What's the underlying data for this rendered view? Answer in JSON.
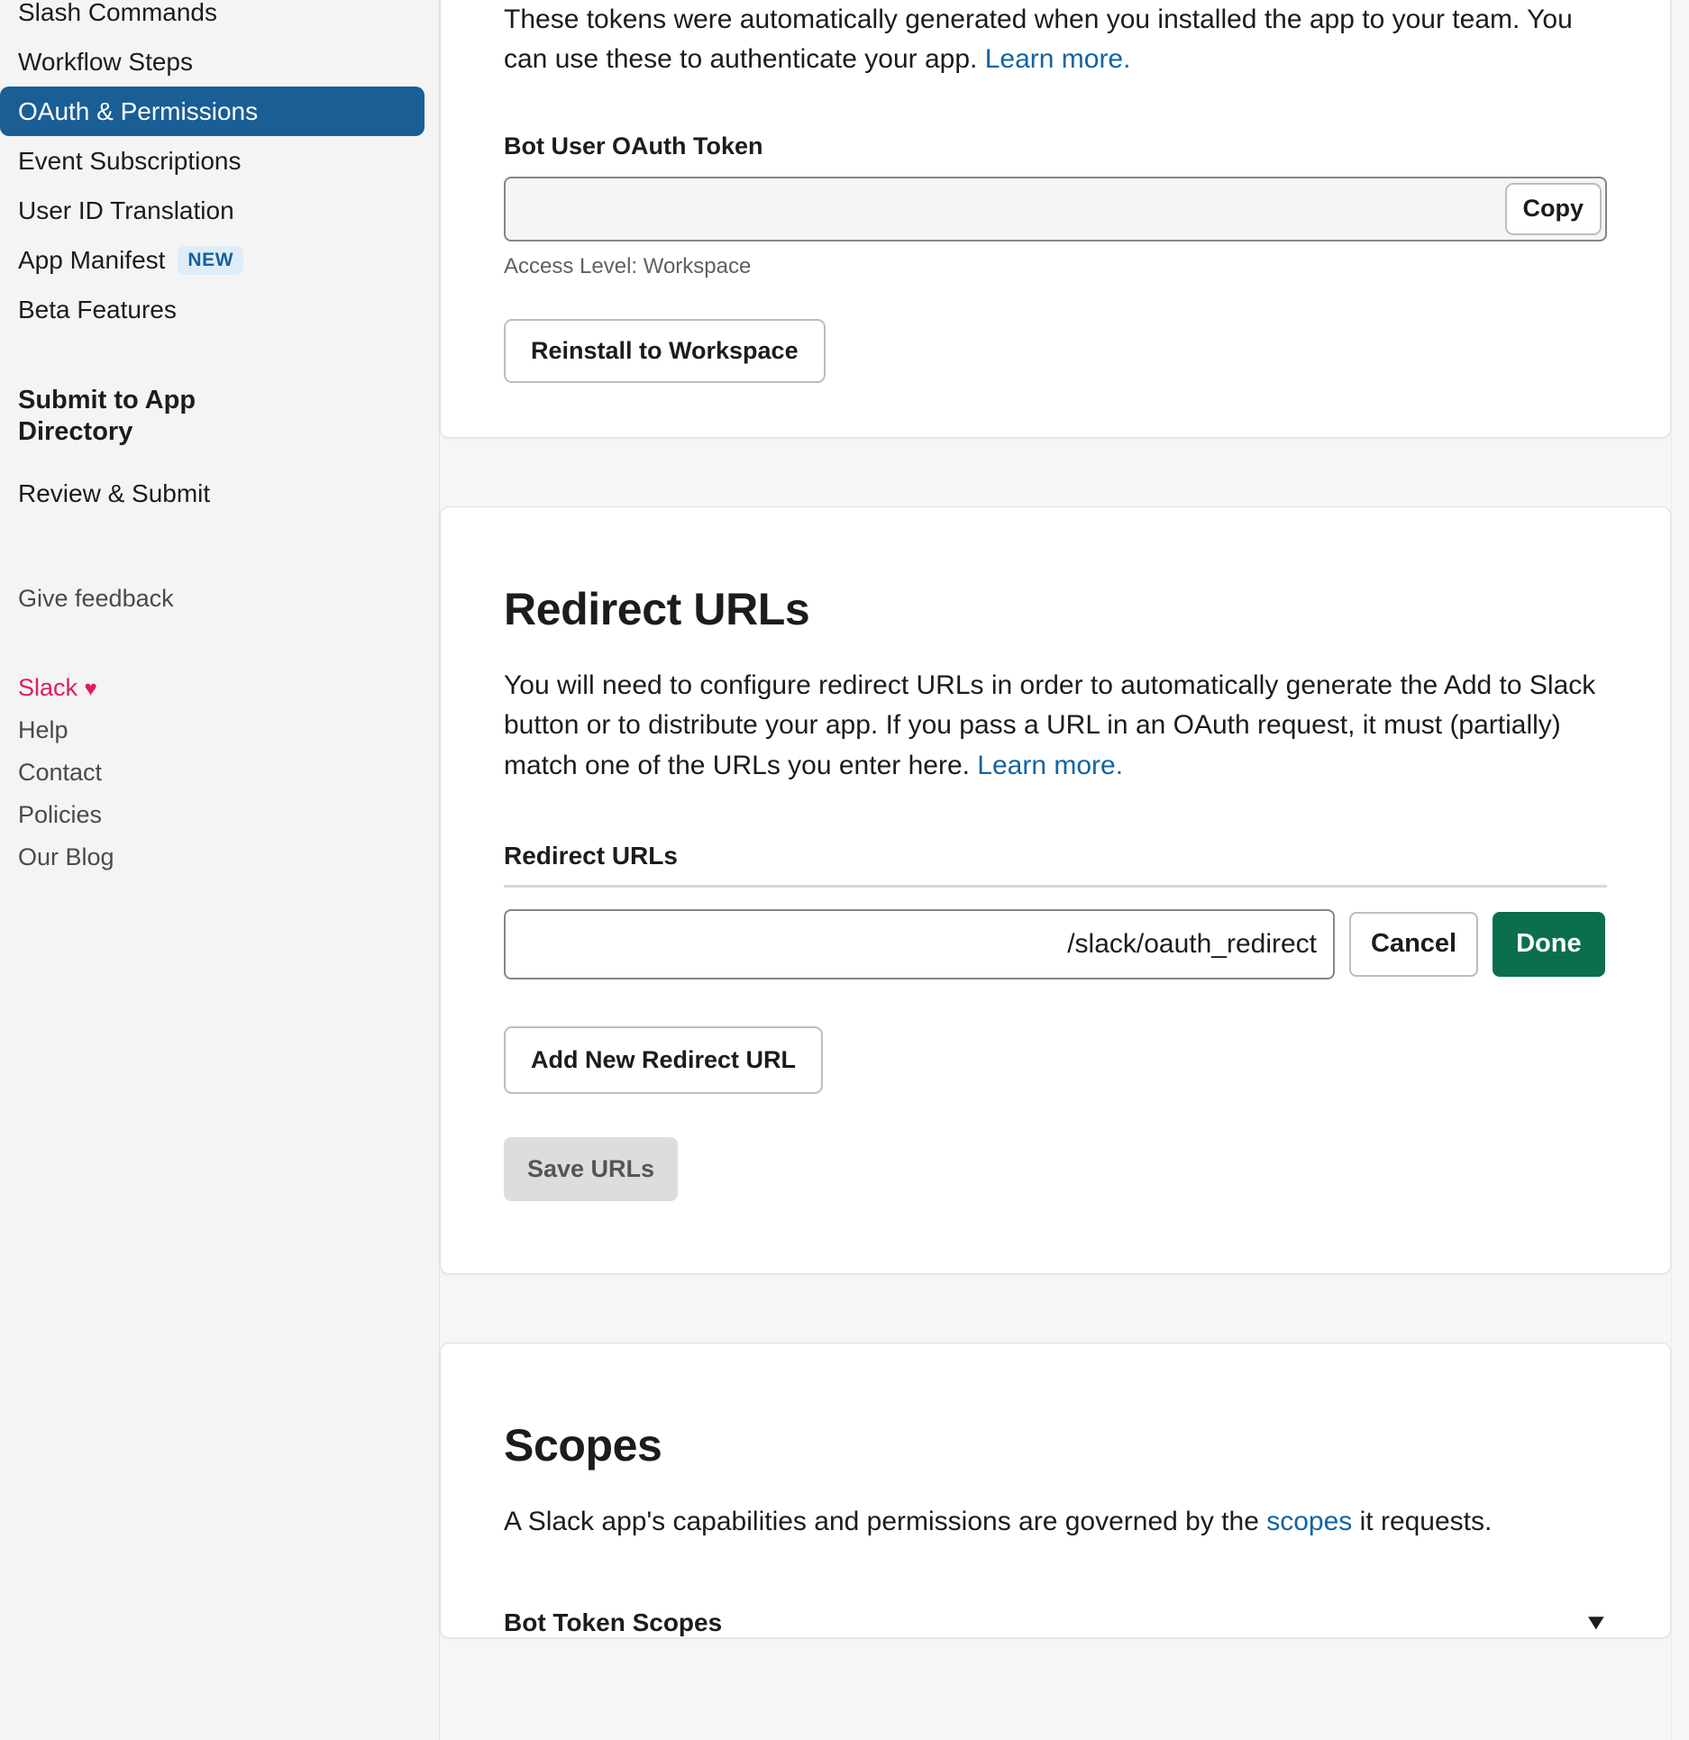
{
  "sidebar": {
    "nav_items": [
      {
        "label": "Slash Commands",
        "selected": false
      },
      {
        "label": "Workflow Steps",
        "selected": false
      },
      {
        "label": "OAuth & Permissions",
        "selected": true
      },
      {
        "label": "Event Subscriptions",
        "selected": false
      },
      {
        "label": "User ID Translation",
        "selected": false
      },
      {
        "label": "App Manifest",
        "selected": false,
        "badge": "NEW"
      },
      {
        "label": "Beta Features",
        "selected": false
      }
    ],
    "section_heading": "Submit to App Directory",
    "sub_items": [
      {
        "label": "Review & Submit"
      }
    ],
    "footer_links": [
      {
        "label": "Give feedback"
      },
      {
        "label": "Slack",
        "heart": "♥"
      },
      {
        "label": "Help"
      },
      {
        "label": "Contact"
      },
      {
        "label": "Policies"
      },
      {
        "label": "Our Blog"
      }
    ]
  },
  "tokens_card": {
    "intro_text": "These tokens were automatically generated when you installed the app to your team. You can use these to authenticate your app. ",
    "intro_link": "Learn more.",
    "bot_token_label": "Bot User OAuth Token",
    "bot_token_value": "",
    "bot_token_placeholder": "",
    "copy_label": "Copy",
    "access_level": "Access Level: Workspace",
    "reinstall_label": "Reinstall to Workspace"
  },
  "redirect_card": {
    "title": "Redirect URLs",
    "description_part1": "You will need to configure redirect URLs in order to automatically generate the Add to Slack button or to distribute your app. If you pass a URL in an OAuth request, it must (partially) match one of the URLs you enter here. ",
    "description_link": "Learn more.",
    "sub_label": "Redirect URLs",
    "url_value": "/slack/oauth_redirect",
    "cancel_label": "Cancel",
    "done_label": "Done",
    "add_label": "Add New Redirect URL",
    "save_label": "Save URLs"
  },
  "scopes_card": {
    "title": "Scopes",
    "description_part1": "A Slack app's capabilities and permissions are governed by the ",
    "description_link": "scopes",
    "description_part2": " it requests.",
    "bot_token_scopes_label": "Bot Token Scopes",
    "chevron": "▼"
  },
  "colors": {
    "accent_blue": "#1264a3",
    "selected_nav": "#1a5e96",
    "slack_pink": "#e01e5a",
    "done_green": "#0b6e4f",
    "badge_bg": "#deedf7",
    "badge_text": "#16619b"
  }
}
